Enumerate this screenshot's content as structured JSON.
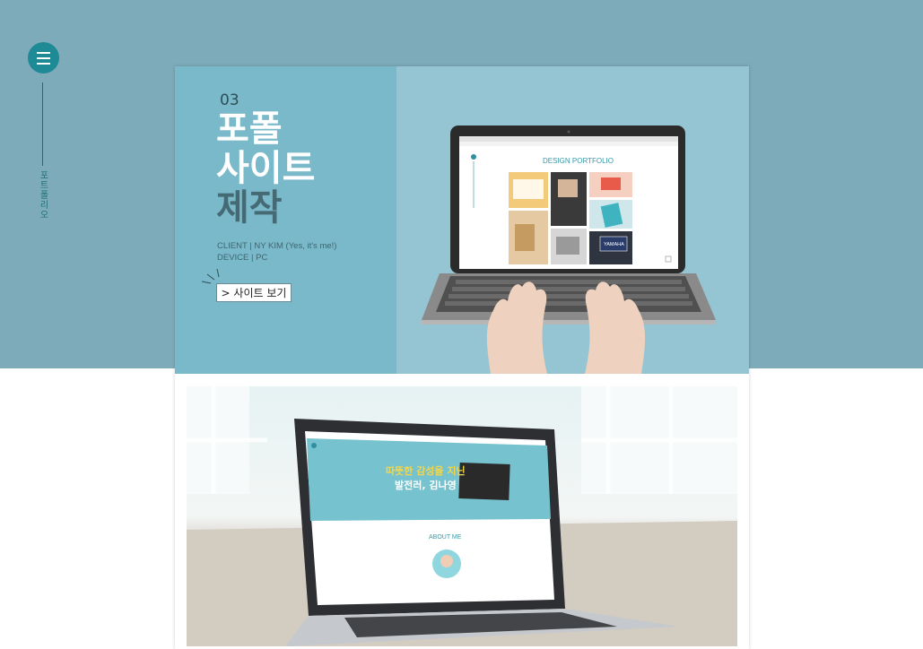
{
  "sidebar": {
    "vertical_label": "포트폴리오",
    "menu_icon": "hamburger-icon"
  },
  "project": {
    "number": "03",
    "title_line1": "포폴",
    "title_line2": "사이트",
    "title_line3": "제작",
    "client_line": "CLIENT |  NY KIM (Yes, it's me!)",
    "device_line": "DEVICE |  PC",
    "view_button": "> 사이트 보기"
  },
  "mockup1": {
    "header": "DESIGN PORTFOLIO",
    "tile_label": "YAMAHA"
  },
  "mockup2": {
    "headline_1": "따뜻한 감성을 지닌",
    "headline_2": "발전러, 김나영",
    "section_label": "ABOUT ME"
  },
  "colors": {
    "band": "#7eabb9",
    "accent": "#1e8a96",
    "panel_left": "#79b9ca",
    "panel_right": "#95c5d3"
  }
}
